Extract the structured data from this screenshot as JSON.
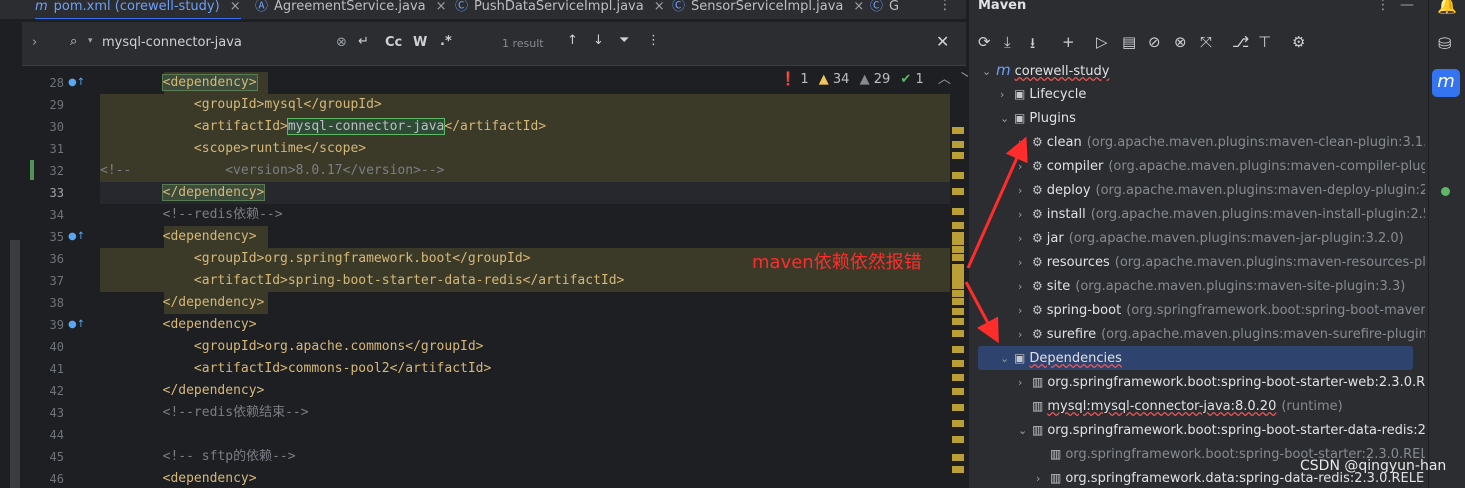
{
  "tabs": [
    {
      "label": "pom.xml (corewell-study)",
      "icon": "m",
      "active": true
    },
    {
      "label": "AgreementService.java",
      "icon": "Ⓐ"
    },
    {
      "label": "PushDataServiceImpl.java",
      "icon": "Ⓒ"
    },
    {
      "label": "SensorServiceImpl.java",
      "icon": "Ⓒ"
    },
    {
      "label": "G",
      "icon": "Ⓒ"
    }
  ],
  "find": {
    "query": "mysql-connector-java",
    "result_count": "1 result",
    "case_label": "Cc",
    "word_label": "W",
    "regex_label": ".*"
  },
  "inspections": {
    "errors": "1",
    "warnings": "34",
    "weak": "29",
    "ok": "1"
  },
  "editor": {
    "lines": [
      {
        "num": "28",
        "text": "<dependency>",
        "indent": "        ",
        "hl": true,
        "gicon": true,
        "tagbox": true
      },
      {
        "num": "29",
        "text": "<groupId>mysql</groupId>",
        "indent": "            ",
        "hl": true
      },
      {
        "num": "30",
        "pre": "<artifactId>",
        "sel": "mysql-connector-java",
        "post": "</artifactId>",
        "indent": "            ",
        "hl": true
      },
      {
        "num": "31",
        "text": "<scope>runtime</scope>",
        "indent": "            ",
        "hl": true
      },
      {
        "num": "32",
        "comment": "<!--            <version>8.0.17</version>-->",
        "indent": "",
        "hl": true
      },
      {
        "num": "33",
        "text": "</dependency>",
        "indent": "        ",
        "hl": true,
        "cur": true,
        "tagbox": true
      },
      {
        "num": "34",
        "comment": "<!--redis依赖-->",
        "indent": "        "
      },
      {
        "num": "35",
        "text": "<dependency>",
        "indent": "        ",
        "hl": true,
        "gicon": true
      },
      {
        "num": "36",
        "text": "<groupId>org.springframework.boot</groupId>",
        "indent": "            ",
        "hl": true
      },
      {
        "num": "37",
        "text": "<artifactId>spring-boot-starter-data-redis</artifactId>",
        "indent": "            ",
        "hl": true
      },
      {
        "num": "38",
        "text": "</dependency>",
        "indent": "        ",
        "hl": true
      },
      {
        "num": "39",
        "text": "<dependency>",
        "indent": "        ",
        "gicon": true
      },
      {
        "num": "40",
        "text": "<groupId>org.apache.commons</groupId>",
        "indent": "            "
      },
      {
        "num": "41",
        "text": "<artifactId>commons-pool2</artifactId>",
        "indent": "            "
      },
      {
        "num": "42",
        "text": "</dependency>",
        "indent": "        "
      },
      {
        "num": "43",
        "comment": "<!--redis依赖结束-->",
        "indent": "        "
      },
      {
        "num": "44",
        "text": "",
        "indent": ""
      },
      {
        "num": "45",
        "comment": "<!-- sftp的依赖-->",
        "indent": "        "
      },
      {
        "num": "46",
        "text": "<dependency>",
        "indent": "        "
      }
    ]
  },
  "annotation": "maven依赖依然报错",
  "maven": {
    "title": "Maven",
    "tree": [
      {
        "label": "corewell-study",
        "icon": "m",
        "level": 0,
        "arrow": "⌄",
        "squig": true
      },
      {
        "label": "Lifecycle",
        "icon": "▣",
        "level": 1,
        "arrow": "›"
      },
      {
        "label": "Plugins",
        "icon": "▣",
        "level": 1,
        "arrow": "⌄"
      },
      {
        "label": "clean",
        "gray": "(org.apache.maven.plugins:maven-clean-plugin:3.1.0",
        "icon": "⚙",
        "level": 2,
        "arrow": "›"
      },
      {
        "label": "compiler",
        "gray": "(org.apache.maven.plugins:maven-compiler-plugin",
        "icon": "⚙",
        "level": 2,
        "arrow": "›"
      },
      {
        "label": "deploy",
        "gray": "(org.apache.maven.plugins:maven-deploy-plugin:2.",
        "icon": "⚙",
        "level": 2,
        "arrow": "›"
      },
      {
        "label": "install",
        "gray": "(org.apache.maven.plugins:maven-install-plugin:2.5.",
        "icon": "⚙",
        "level": 2,
        "arrow": "›"
      },
      {
        "label": "jar",
        "gray": "(org.apache.maven.plugins:maven-jar-plugin:3.2.0)",
        "icon": "⚙",
        "level": 2,
        "arrow": "›"
      },
      {
        "label": "resources",
        "gray": "(org.apache.maven.plugins:maven-resources-plu",
        "icon": "⚙",
        "level": 2,
        "arrow": "›"
      },
      {
        "label": "site",
        "gray": "(org.apache.maven.plugins:maven-site-plugin:3.3)",
        "icon": "⚙",
        "level": 2,
        "arrow": "›"
      },
      {
        "label": "spring-boot",
        "gray": "(org.springframework.boot:spring-boot-maver",
        "icon": "⚙",
        "level": 2,
        "arrow": "›"
      },
      {
        "label": "surefire",
        "gray": "(org.apache.maven.plugins:maven-surefire-plugin:",
        "icon": "⚙",
        "level": 2,
        "arrow": "›"
      },
      {
        "label": "Dependencies",
        "icon": "▣",
        "level": 1,
        "arrow": "⌄",
        "squig": true,
        "selected": true
      },
      {
        "label": "org.springframework.boot:spring-boot-starter-web:2.3.0.R",
        "icon": "▥",
        "level": 2,
        "arrow": "›"
      },
      {
        "label": "mysql:mysql-connector-java:8.0.20",
        "gray": "(runtime)",
        "icon": "▥",
        "level": 2,
        "arrow": "",
        "squig": true
      },
      {
        "label": "org.springframework.boot:spring-boot-starter-data-redis:2",
        "icon": "▥",
        "level": 2,
        "arrow": "⌄"
      },
      {
        "label": "org.springframework.boot:spring-boot-starter:2.3.0.REL",
        "icon": "▥",
        "level": 3,
        "arrow": "",
        "dim": true
      },
      {
        "label": "org.springframework.data:spring-data-redis:2.3.0.RELE",
        "icon": "▥",
        "level": 3,
        "arrow": "›"
      }
    ]
  },
  "watermark": "CSDN @qingyun-han",
  "colors": {
    "accent": "#3574f0",
    "annotation": "#ff2c2c",
    "highlight": "#3b3a28",
    "error": "#e55757"
  }
}
